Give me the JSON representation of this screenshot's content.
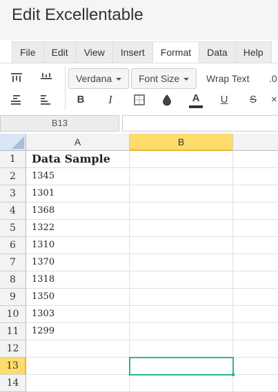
{
  "app": {
    "title": "Edit Excellentable"
  },
  "menu": {
    "tabs": [
      {
        "label": "File"
      },
      {
        "label": "Edit"
      },
      {
        "label": "View"
      },
      {
        "label": "Insert"
      },
      {
        "label": "Format",
        "active": true
      },
      {
        "label": "Data"
      },
      {
        "label": "Help"
      }
    ]
  },
  "toolbar": {
    "font_family": "Verdana",
    "font_size": "Font Size",
    "wrap_text": "Wrap Text",
    "decimal": ".0",
    "bold": "B",
    "italic": "I",
    "text_color": "A",
    "underline": "U",
    "strike": "S",
    "more": "×"
  },
  "formula_bar": {
    "cell_ref": "B13",
    "value": ""
  },
  "sheet": {
    "columns": [
      "A",
      "B"
    ],
    "selected_column": "B",
    "selected_row": 13,
    "rows": [
      {
        "num": "1",
        "a": "Data Sample"
      },
      {
        "num": "2",
        "a": "1345"
      },
      {
        "num": "3",
        "a": "1301"
      },
      {
        "num": "4",
        "a": "1368"
      },
      {
        "num": "5",
        "a": "1322"
      },
      {
        "num": "6",
        "a": "1310"
      },
      {
        "num": "7",
        "a": "1370"
      },
      {
        "num": "8",
        "a": "1318"
      },
      {
        "num": "9",
        "a": "1350"
      },
      {
        "num": "10",
        "a": "1303"
      },
      {
        "num": "11",
        "a": "1299"
      },
      {
        "num": "12",
        "a": ""
      },
      {
        "num": "13",
        "a": ""
      },
      {
        "num": "14",
        "a": ""
      }
    ]
  },
  "colors": {
    "selection": "#2bb78b",
    "header_highlight": "#fddc6c"
  }
}
